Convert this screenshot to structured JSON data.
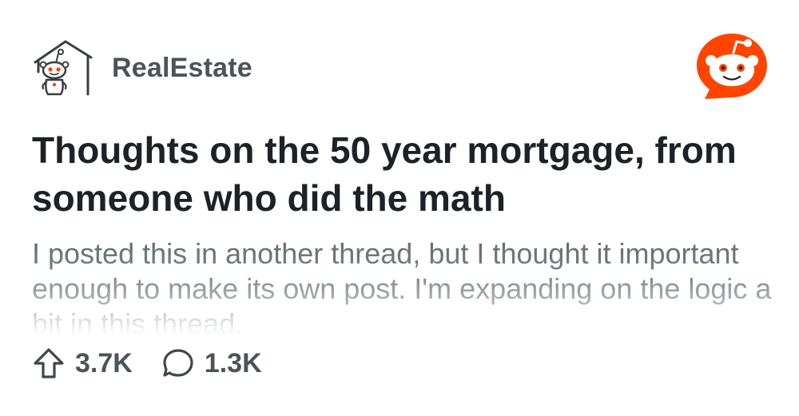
{
  "subreddit": {
    "name": "RealEstate",
    "icon": "house-snoo-icon"
  },
  "brand": {
    "logo": "reddit-snoo-logo",
    "color": "#ff4500"
  },
  "post": {
    "title": "Thoughts on the 50 year mortgage, from someone who did the math",
    "body_preview": "I posted this in another thread, but I thought it important enough to make its own post. I'm expanding on the logic a bit in this thread."
  },
  "stats": {
    "upvotes": "3.7K",
    "upvote_icon": "upvote-arrow-icon",
    "comments": "1.3K",
    "comment_icon": "comment-bubble-icon"
  },
  "colors": {
    "text_primary": "#1c2226",
    "text_secondary": "#4a5459",
    "text_body": "#5f6a70",
    "background": "#ffffff"
  }
}
